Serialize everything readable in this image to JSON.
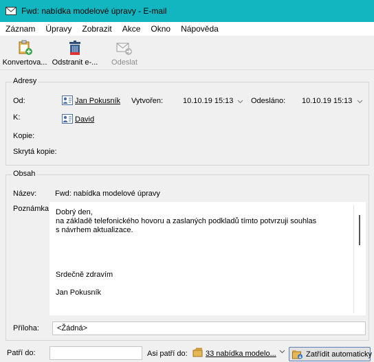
{
  "window": {
    "title": "Fwd: nabídka modelové úpravy - E-mail"
  },
  "menu": [
    "Záznam",
    "Úpravy",
    "Zobrazit",
    "Akce",
    "Okno",
    "Nápověda"
  ],
  "toolbar": {
    "convert_label": "Konvertova...",
    "delete_label": "Odstranit e-...",
    "send_label": "Odeslat"
  },
  "addresses": {
    "group_title": "Adresy",
    "from_label": "Od:",
    "from_value": "Jan Pokusník",
    "to_label": "K:",
    "to_value": "David",
    "cc_label": "Kopie:",
    "bcc_label": "Skrytá kopie:",
    "created_label": "Vytvořen:",
    "created_value": "10.10.19 15:13",
    "sent_label": "Odesláno:",
    "sent_value": "10.10.19 15:13"
  },
  "content": {
    "group_title": "Obsah",
    "subject_label": "Název:",
    "subject_value": "Fwd: nabídka modelové úpravy",
    "note_label": "Poznámka:",
    "note_lines": [
      "Dobrý den,",
      "na základě telefonického hovoru a zaslaných podkladů tímto potvrzuji souhlas",
      "s návrhem aktualizace.",
      "Srdečně zdravím",
      "Jan Pokusník"
    ],
    "attachment_label": "Příloha:",
    "attachment_value": "<Žádná>"
  },
  "footer": {
    "belongs_label": "Patří do:",
    "belongs_value": "",
    "maybe_label": "Asi patří do:",
    "maybe_value": "33 nabídka modelo...",
    "auto_sort_label": "Zatřídit automaticky"
  }
}
